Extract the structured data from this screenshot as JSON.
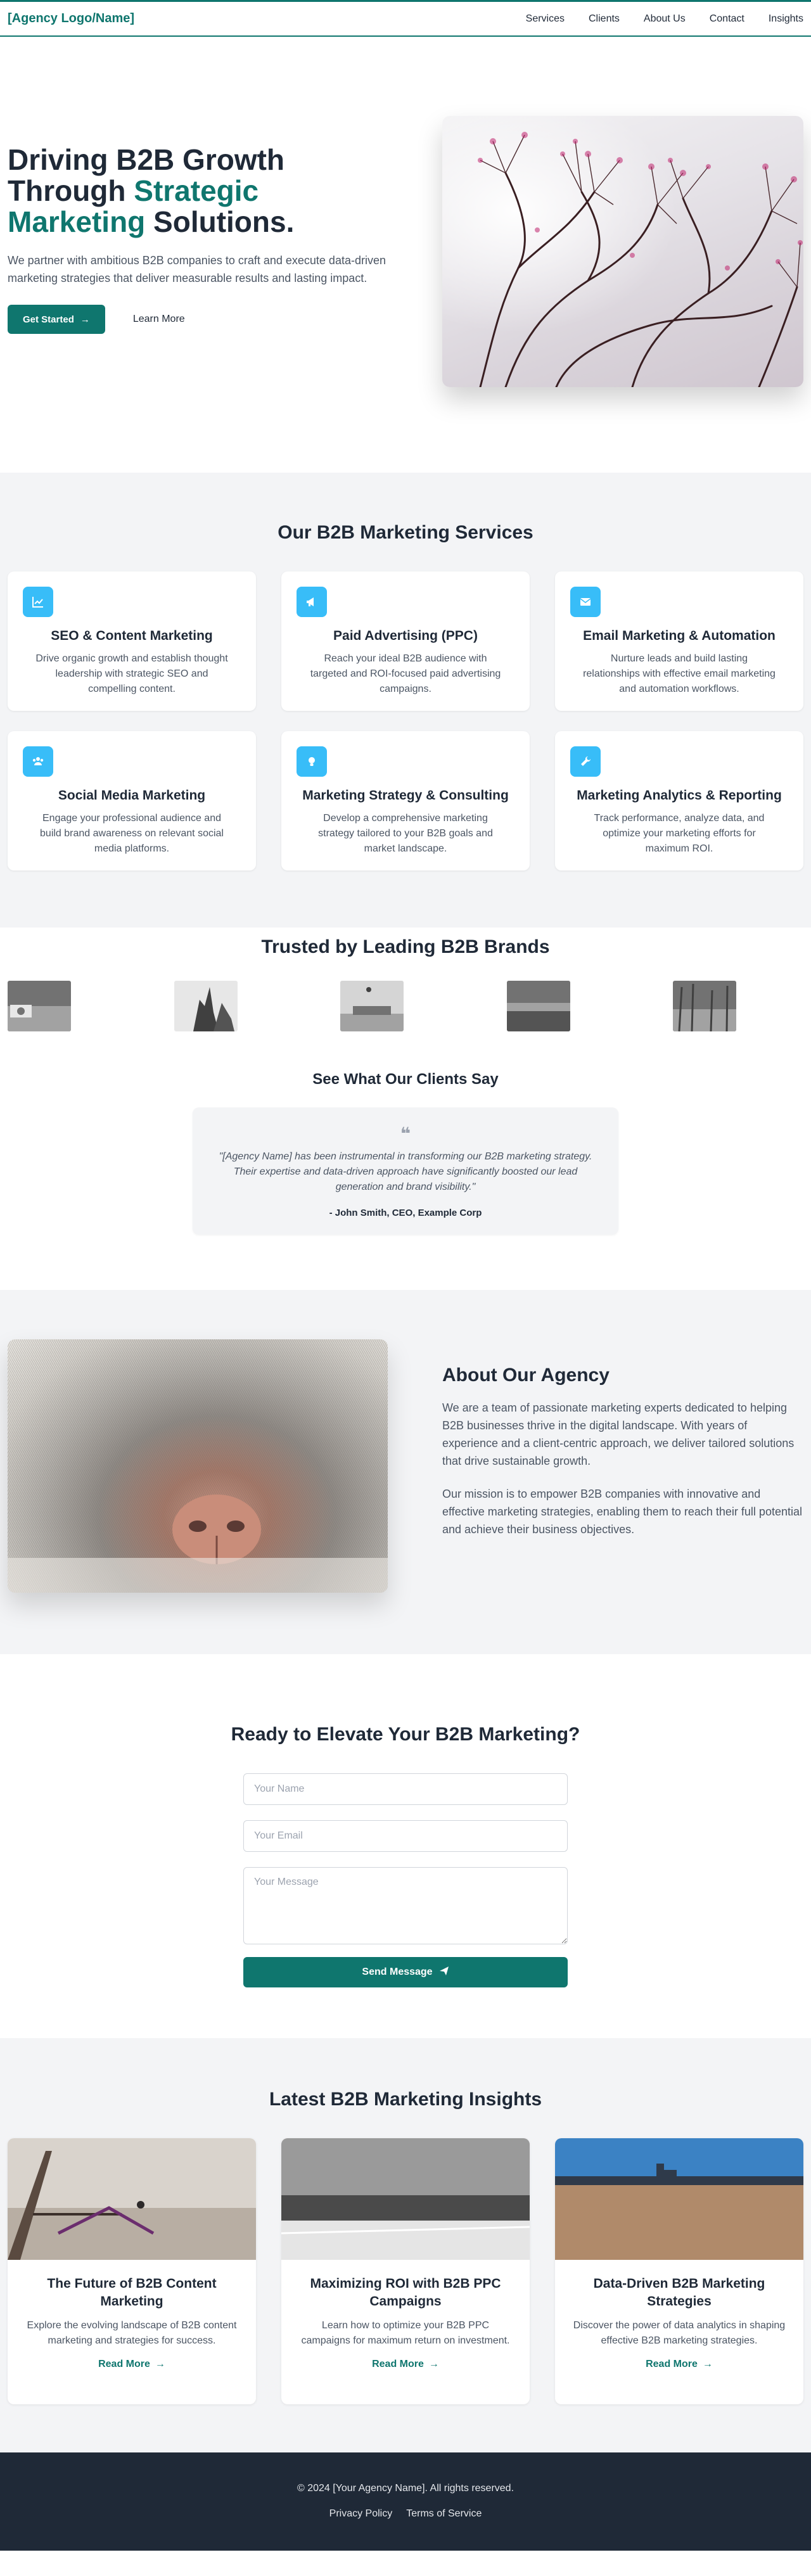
{
  "header": {
    "logo": "[Agency Logo/Name]",
    "nav": [
      {
        "label": "Services"
      },
      {
        "label": "Clients"
      },
      {
        "label": "About Us"
      },
      {
        "label": "Contact"
      },
      {
        "label": "Insights"
      }
    ]
  },
  "hero": {
    "title_line1": "Driving B2B Growth",
    "title_line2_prefix": "Through ",
    "title_line2_accent": "Strategic",
    "title_line3_accent": "Marketing",
    "title_line3_suffix": " Solutions.",
    "subtitle": "We partner with ambitious B2B companies to craft and execute data-driven marketing strategies that deliver measurable results and lasting impact.",
    "cta_primary": "Get Started",
    "cta_secondary": "Learn More"
  },
  "services": {
    "title": "Our B2B Marketing Services",
    "items": [
      {
        "icon": "chart-line-icon",
        "name": "SEO & Content Marketing",
        "desc": "Drive organic growth and establish thought leadership with strategic SEO and compelling content."
      },
      {
        "icon": "megaphone-icon",
        "name": "Paid Advertising (PPC)",
        "desc": "Reach your ideal B2B audience with targeted and ROI-focused paid advertising campaigns."
      },
      {
        "icon": "envelope-icon",
        "name": "Email Marketing & Automation",
        "desc": "Nurture leads and build lasting relationships with effective email marketing and automation workflows."
      },
      {
        "icon": "users-icon",
        "name": "Social Media Marketing",
        "desc": "Engage your professional audience and build brand awareness on relevant social media platforms."
      },
      {
        "icon": "lightbulb-icon",
        "name": "Marketing Strategy & Consulting",
        "desc": "Develop a comprehensive marketing strategy tailored to your B2B goals and market landscape."
      },
      {
        "icon": "wrench-icon",
        "name": "Marketing Analytics & Reporting",
        "desc": "Track performance, analyze data, and optimize your marketing efforts for maximum ROI."
      }
    ]
  },
  "trusted": {
    "title": "Trusted by Leading B2B Brands",
    "testimonials_title": "See What Our Clients Say",
    "quote": "\"[Agency Name] has been instrumental in transforming our B2B marketing strategy. Their expertise and data-driven approach have significantly boosted our lead generation and brand visibility.\"",
    "author": "- John Smith, CEO, Example Corp"
  },
  "about": {
    "title": "About Our Agency",
    "p1": "We are a team of passionate marketing experts dedicated to helping B2B businesses thrive in the digital landscape. With years of experience and a client-centric approach, we deliver tailored solutions that drive sustainable growth.",
    "p2": "Our mission is to empower B2B companies with innovative and effective marketing strategies, enabling them to reach their full potential and achieve their business objectives."
  },
  "contact": {
    "title": "Ready to Elevate Your B2B Marketing?",
    "name_placeholder": "Your Name",
    "email_placeholder": "Your Email",
    "message_placeholder": "Your Message",
    "submit": "Send Message"
  },
  "insights": {
    "title": "Latest B2B Marketing Insights",
    "posts": [
      {
        "title": "The Future of B2B Content Marketing",
        "excerpt": "Explore the evolving landscape of B2B content marketing and strategies for success.",
        "link": "Read More"
      },
      {
        "title": "Maximizing ROI with B2B PPC Campaigns",
        "excerpt": "Learn how to optimize your B2B PPC campaigns for maximum return on investment.",
        "link": "Read More"
      },
      {
        "title": "Data-Driven B2B Marketing Strategies",
        "excerpt": "Discover the power of data analytics in shaping effective B2B marketing strategies.",
        "link": "Read More"
      }
    ]
  },
  "footer": {
    "copyright": "© 2024 [Your Agency Name]. All rights reserved.",
    "links": [
      {
        "label": "Privacy Policy"
      },
      {
        "label": "Terms of Service"
      }
    ]
  },
  "colors": {
    "brand": "#0f766e",
    "icon_bg": "#38bdf8",
    "section_bg": "#f3f4f6",
    "footer_bg": "#1f2937"
  }
}
